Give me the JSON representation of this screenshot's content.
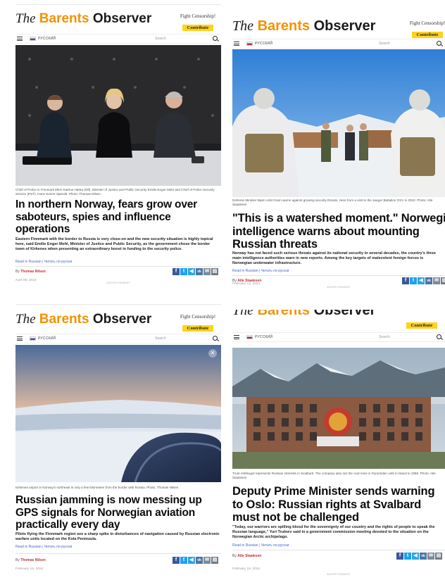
{
  "site": {
    "logo_the": "The",
    "logo_barents": "Barents",
    "logo_observer": "Observer",
    "fight_censorship": "Fight Censorship!",
    "contribute": "Contribute",
    "lang_label": "РУССКИЙ",
    "search_placeholder": "Search",
    "advertisement": "ADVERTISEMENT"
  },
  "colors": {
    "brand_orange": "#f39200",
    "contribute_yellow": "#ffd21f",
    "link_blue": "#4a67c8",
    "author_red": "#c03030"
  },
  "share_icons": [
    {
      "name": "facebook-icon",
      "glyph": "f"
    },
    {
      "name": "twitter-icon",
      "glyph": "t"
    },
    {
      "name": "telegram-icon",
      "glyph": "◀"
    },
    {
      "name": "vk-icon",
      "glyph": "vk"
    },
    {
      "name": "email-icon",
      "glyph": "✉"
    },
    {
      "name": "print-icon",
      "glyph": "▤"
    }
  ],
  "articles": [
    {
      "caption": "Chief of Police in Finnmark Ellen Katrine Hætta (left), Minister of Justice and Public Security Emilie Enger Mehl and Chief of Police Security Service (PST), Hans Sverre Sjøvold. Photo: Thomas Nilsen",
      "headline": "In northern Norway, fears grow over saboteurs, spies and influence operations",
      "lead": "Eastern Finnmark with the border to Russia is very close-on and the new security situation is highly topical here, said Emilie Enger Mehl, Minister of Justice and Public Security, as the government chose the border town of Kirkenes when presenting an extraordinary boost in funding to the security police.",
      "read_in": "Read in Russian | Читать по-русски",
      "by": "By",
      "author": "Thomas Nilsen",
      "date": "April 06, 2023"
    },
    {
      "caption": "Defense Minister Bjørn Arild Gram warns against growing security threats. Here from a visit to the Jaeger Battalion GSV in 2022. Photo: Atle Staalesen",
      "headline": "\"This is a watershed moment.\" Norwegian intelligence warns about mounting Russian threats",
      "lead": "Norway has not faced such serious threats against its national security in several decades, the country's three main intelligence authorities warn in new reports. Among the key targets of malevolent foreign forces is Norwegian underwater infrastructure.",
      "read_in": "Read in Russian | Читать по-русски",
      "by": "By",
      "author": "Atle Staalesen",
      "date": "February 12, 2024"
    },
    {
      "caption": "Kirkenes airport in Norway's northeast is only a few kilometers from the border with Russia. Photo: Thomas Nilsen",
      "headline": "Russian jamming is now messing up GPS signals for Norwegian aviation practically every day",
      "lead": "Pilots flying the Finnmark region see a sharp spike in disturbances of navigation caused by Russian electronic warfare units located on the Kola Peninsula.",
      "read_in": "Read in Russian | Читать по-русски",
      "by": "By",
      "author": "Thomas Nilsen",
      "date": "February 16, 2024"
    },
    {
      "caption": "Trust Arktikugol represents Russian interests in Svalbard. The company also ran the coal mine in Pyramiden until it closed in 1998. Photo: Atle Staalesen",
      "headline": "Deputy Prime Minister sends warning to Oslo: Russian rights at Svalbard must not be challenged",
      "lead": "\"Today, our warriors are spilling blood for the sovereignty of our country and the rights of people to speak the Russian language,\" Yuri Trutnev said in a government commission meeting devoted to the situation on the Norwegian Arctic archipelago.",
      "read_in": "Read in Russian | Читать по-русски",
      "by": "By",
      "author": "Atle Staalesen",
      "date": "February 15, 2024"
    }
  ]
}
